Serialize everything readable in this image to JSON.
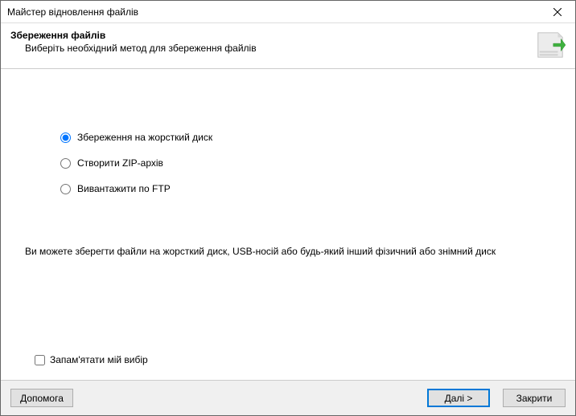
{
  "titlebar": {
    "title": "Майстер відновлення файлів"
  },
  "header": {
    "title": "Збереження файлів",
    "subtitle": "Виберіть необхідний метод для збереження файлів"
  },
  "options": [
    {
      "label": "Збереження на жорсткий диск",
      "selected": true
    },
    {
      "label": "Створити ZIP-архів",
      "selected": false
    },
    {
      "label": "Вивантажити по FTP",
      "selected": false
    }
  ],
  "description": "Ви можете зберегти файли на жорсткий диск, USB-носій або будь-який інший фізичний або знімний диск",
  "remember": {
    "label": "Запам'ятати мій вибір",
    "checked": false
  },
  "buttons": {
    "help": "Допомога",
    "next": "Далі >",
    "close": "Закрити"
  }
}
